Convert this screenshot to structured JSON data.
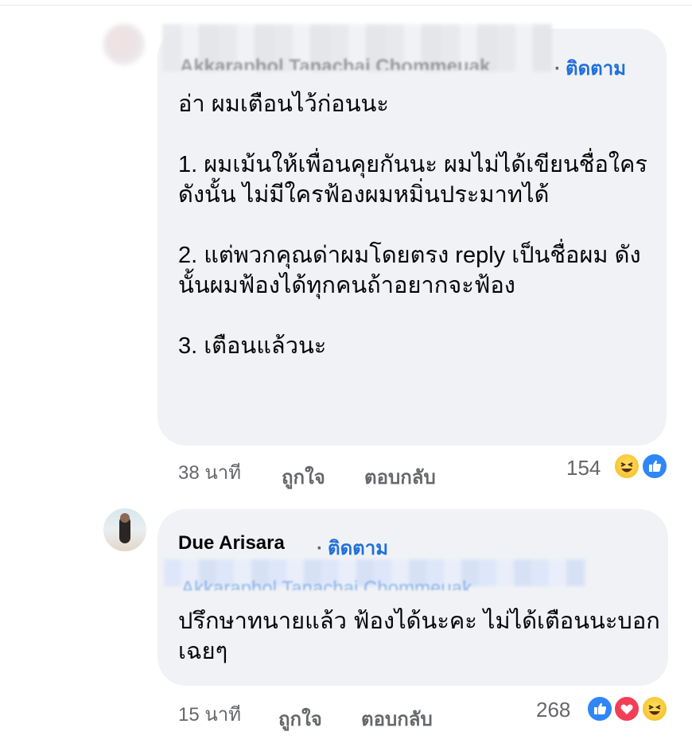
{
  "comment1": {
    "author": "Akkaraphol Tanachai Chommeuak",
    "follow_label": "ติดตาม",
    "text": "อ่า ผมเตือนไว้ก่อนนะ\n\n1. ผมเม้นให้เพื่อนคุยกันนะ ผมไม่ได้เขียนชื่อใคร ดังนั้น ไม่มีใครฟ้องผมหมิ่นประมาทได้\n\n2. แต่พวกคุณด่าผมโดยตรง reply เป็นชื่อผม ดังนั้นผมฟ้องได้ทุกคนถ้าอยากจะฟ้อง\n\n3. เตือนแล้วนะ",
    "time": "38 นาที",
    "like_label": "ถูกใจ",
    "reply_label": "ตอบกลับ",
    "reaction_count": "154",
    "reactions": [
      "haha-icon",
      "like-icon"
    ]
  },
  "comment2": {
    "author": "Due Arisara",
    "follow_label": "ติดตาม",
    "tagged_name": "Akkaraphol Tanachai Chommeuak",
    "text": "ปรึกษาทนายแล้ว ฟ้องได้นะคะ ไม่ได้เตือนนะบอกเฉยๆ",
    "time": "15 นาที",
    "like_label": "ถูกใจ",
    "reply_label": "ตอบกลับ",
    "reaction_count": "268",
    "reactions": [
      "like-icon",
      "love-icon",
      "haha-icon"
    ]
  },
  "colors": {
    "bubble": "#f0f2f5",
    "link": "#216fdb",
    "meta": "#65676b"
  }
}
